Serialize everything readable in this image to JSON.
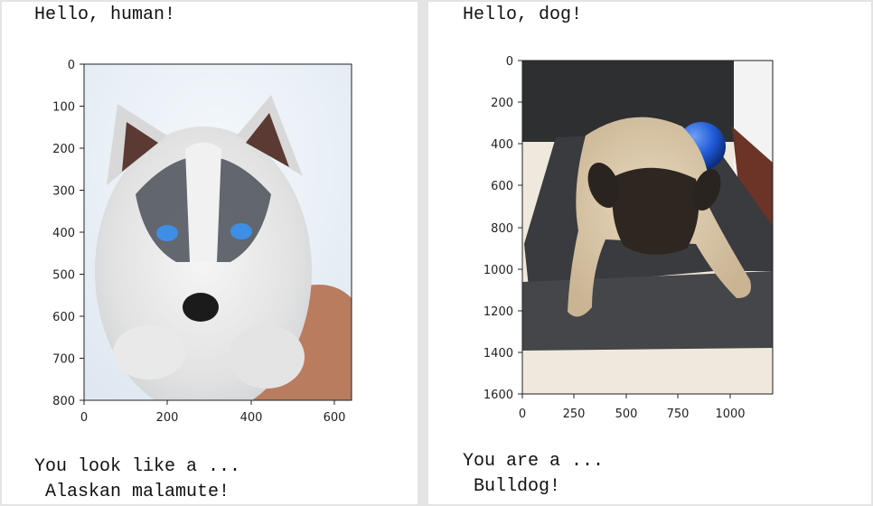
{
  "left_panel": {
    "greeting": "Hello, human!",
    "result_line1": "You look like a ...",
    "result_line2": " Alaskan malamute!",
    "plot": {
      "image_subject": "husky puppy photo",
      "y_ticks": [
        "0",
        "100",
        "200",
        "300",
        "400",
        "500",
        "600",
        "700",
        "800"
      ],
      "x_ticks": [
        "0",
        "200",
        "400",
        "600"
      ]
    }
  },
  "right_panel": {
    "greeting": "Hello, dog!",
    "result_line1": "You are a ...",
    "result_line2": " Bulldog!",
    "plot": {
      "image_subject": "pug lying on mat photo",
      "y_ticks": [
        "0",
        "200",
        "400",
        "600",
        "800",
        "1000",
        "1200",
        "1400",
        "1600"
      ],
      "x_ticks": [
        "0",
        "250",
        "500",
        "750",
        "1000"
      ]
    }
  }
}
